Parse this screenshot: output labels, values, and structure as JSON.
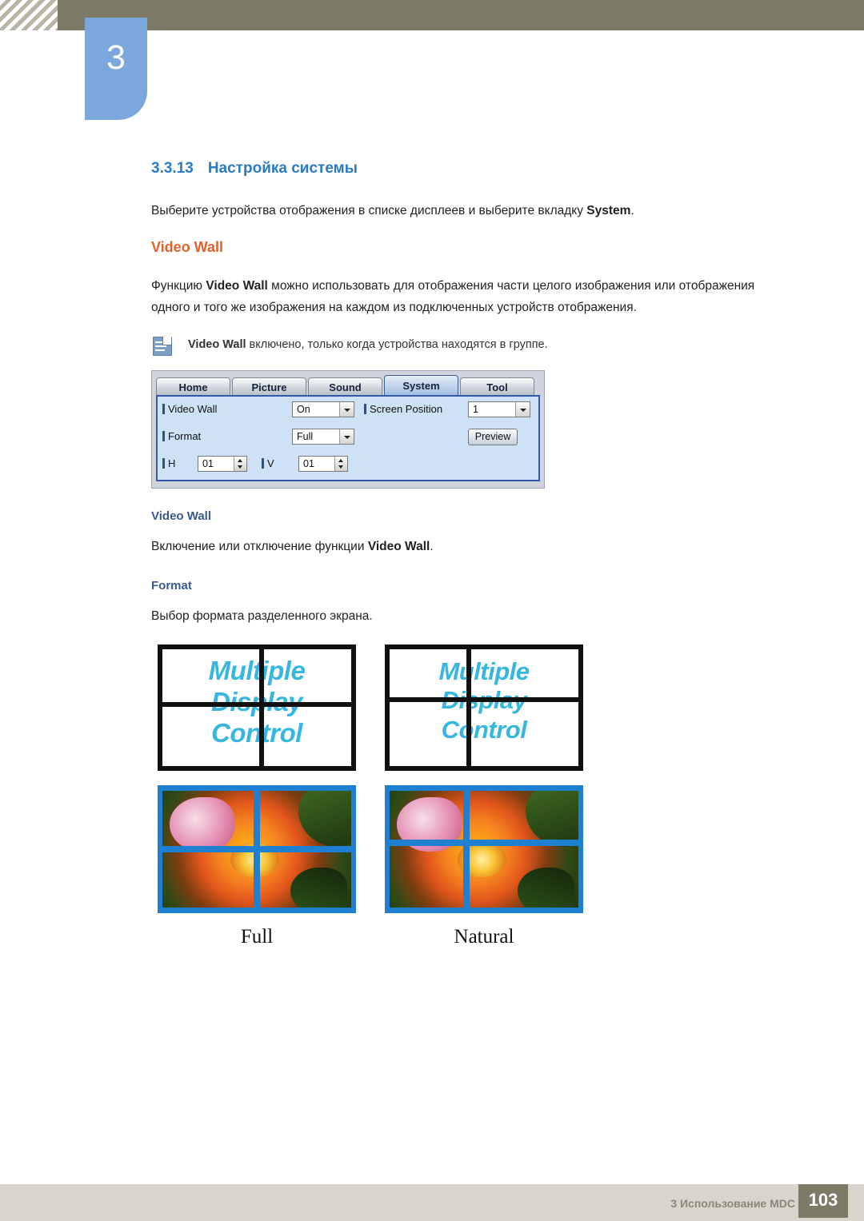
{
  "header": {
    "chapter_number": "3",
    "chapter_title": "Использование MDC"
  },
  "section": {
    "number": "3.3.13",
    "title": "Настройка системы",
    "intro_before": "Выберите устройства отображения в списке дисплеев и выберите вкладку ",
    "intro_bold": "System",
    "intro_after": "."
  },
  "video_wall": {
    "heading": "Video Wall",
    "desc_1": "Функцию ",
    "desc_bold_1": "Video Wall",
    "desc_2": " можно использовать для отображения части целого изображения или отображения одного и того же изображения на каждом из подключенных устройств отображения.",
    "note_bold": "Video Wall",
    "note_text": " включено, только когда устройства находятся в группе.",
    "sub_heading": "Video Wall",
    "sub_text_1": "Включение или отключение функции ",
    "sub_text_bold": "Video Wall",
    "sub_text_2": "."
  },
  "mdc_ui": {
    "tabs": [
      {
        "label": "Home",
        "active": false
      },
      {
        "label": "Picture",
        "active": false
      },
      {
        "label": "Sound",
        "active": false
      },
      {
        "label": "System",
        "active": true
      },
      {
        "label": "Tool",
        "active": false
      }
    ],
    "fields": {
      "video_wall_label": "Video Wall",
      "video_wall_value": "On",
      "format_label": "Format",
      "format_value": "Full",
      "h_label": "H",
      "h_value": "01",
      "v_label": "V",
      "v_value": "01",
      "screen_position_label": "Screen Position",
      "screen_position_value": "1",
      "preview_button": "Preview"
    }
  },
  "format_section": {
    "heading": "Format",
    "text": "Выбор формата разделенного экрана.",
    "wall_text_line1": "Multiple",
    "wall_text_line2": "Display",
    "wall_text_line3": "Control",
    "caption_left": "Full",
    "caption_right": "Natural"
  },
  "footer": {
    "text": "3 Использование MDC",
    "page": "103"
  },
  "colors": {
    "header_bar": "#7d7a68",
    "badge": "#7ba7dd",
    "section_heading": "#2b7bc4",
    "orange_heading": "#e0622a",
    "wall_text": "#37b6e0",
    "photo_frame": "#1f7fd0"
  }
}
